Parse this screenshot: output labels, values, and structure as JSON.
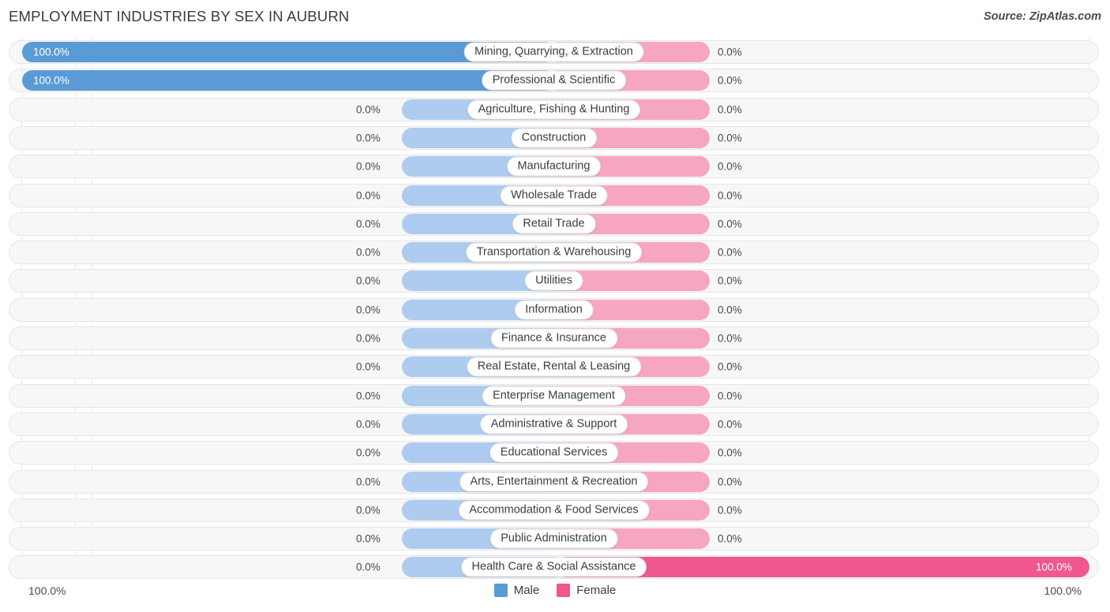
{
  "header": {
    "title": "EMPLOYMENT INDUSTRIES BY SEX IN AUBURN",
    "source": "Source: ZipAtlas.com"
  },
  "footer": {
    "axis_left": "100.0%",
    "axis_right": "100.0%"
  },
  "legend": {
    "items": [
      {
        "label": "Male",
        "color": "#5B9BD5"
      },
      {
        "label": "Female",
        "color": "#F0578E"
      }
    ]
  },
  "colors": {
    "male_strong": "#5B9BD5",
    "male_faint": "#AECCF0",
    "female_strong": "#F0578E",
    "female_faint": "#F6A6C3",
    "row_bg": "#f7f7f7",
    "row_border": "#e6e6e6"
  },
  "chart_data": {
    "type": "bar",
    "subtype": "diverging-bidirectional",
    "title": "EMPLOYMENT INDUSTRIES BY SEX IN AUBURN",
    "xlabel": "",
    "ylabel": "",
    "xlim": [
      100.0,
      100.0
    ],
    "grid": true,
    "legend_position": "bottom-center",
    "categories": [
      "Mining, Quarrying, & Extraction",
      "Professional & Scientific",
      "Agriculture, Fishing & Hunting",
      "Construction",
      "Manufacturing",
      "Wholesale Trade",
      "Retail Trade",
      "Transportation & Warehousing",
      "Utilities",
      "Information",
      "Finance & Insurance",
      "Real Estate, Rental & Leasing",
      "Enterprise Management",
      "Administrative & Support",
      "Educational Services",
      "Arts, Entertainment & Recreation",
      "Accommodation & Food Services",
      "Public Administration",
      "Health Care & Social Assistance"
    ],
    "series": [
      {
        "name": "Male",
        "color": "#5B9BD5",
        "values": [
          100.0,
          100.0,
          0.0,
          0.0,
          0.0,
          0.0,
          0.0,
          0.0,
          0.0,
          0.0,
          0.0,
          0.0,
          0.0,
          0.0,
          0.0,
          0.0,
          0.0,
          0.0,
          0.0
        ],
        "labels": [
          "100.0%",
          "100.0%",
          "0.0%",
          "0.0%",
          "0.0%",
          "0.0%",
          "0.0%",
          "0.0%",
          "0.0%",
          "0.0%",
          "0.0%",
          "0.0%",
          "0.0%",
          "0.0%",
          "0.0%",
          "0.0%",
          "0.0%",
          "0.0%",
          "0.0%"
        ]
      },
      {
        "name": "Female",
        "color": "#F0578E",
        "values": [
          0.0,
          0.0,
          0.0,
          0.0,
          0.0,
          0.0,
          0.0,
          0.0,
          0.0,
          0.0,
          0.0,
          0.0,
          0.0,
          0.0,
          0.0,
          0.0,
          0.0,
          0.0,
          100.0
        ],
        "labels": [
          "0.0%",
          "0.0%",
          "0.0%",
          "0.0%",
          "0.0%",
          "0.0%",
          "0.0%",
          "0.0%",
          "0.0%",
          "0.0%",
          "0.0%",
          "0.0%",
          "0.0%",
          "0.0%",
          "0.0%",
          "0.0%",
          "0.0%",
          "0.0%",
          "100.0%"
        ]
      }
    ]
  }
}
